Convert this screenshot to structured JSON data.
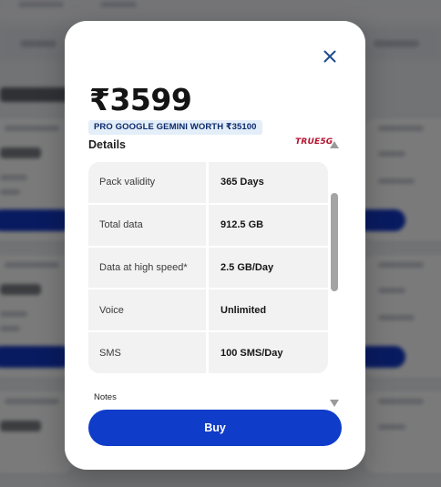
{
  "plan": {
    "price": "₹3599",
    "offer_badge": "PRO GOOGLE GEMINI WORTH ₹35100",
    "brand_logo": "TRUE5G"
  },
  "details": {
    "title": "Details",
    "rows": [
      {
        "label": "Pack validity",
        "value": "365 Days"
      },
      {
        "label": "Total data",
        "value": "912.5 GB"
      },
      {
        "label": "Data at high speed*",
        "value": "2.5 GB/Day"
      },
      {
        "label": "Voice",
        "value": "Unlimited"
      },
      {
        "label": "SMS",
        "value": "100 SMS/Day"
      }
    ]
  },
  "notes_label": "Notes",
  "buy_label": "Buy",
  "icons": {
    "close": "close-icon",
    "scroll_up": "scroll-up-arrow-icon",
    "scroll_down": "scroll-down-arrow-icon"
  },
  "colors": {
    "primary_button": "#0f3cc9",
    "close_icon": "#1e4d8c",
    "offer_badge_bg": "#e3eef8",
    "offer_badge_text": "#0c2a6e",
    "brand_logo": "#b4122e",
    "overlay": "#000000"
  }
}
